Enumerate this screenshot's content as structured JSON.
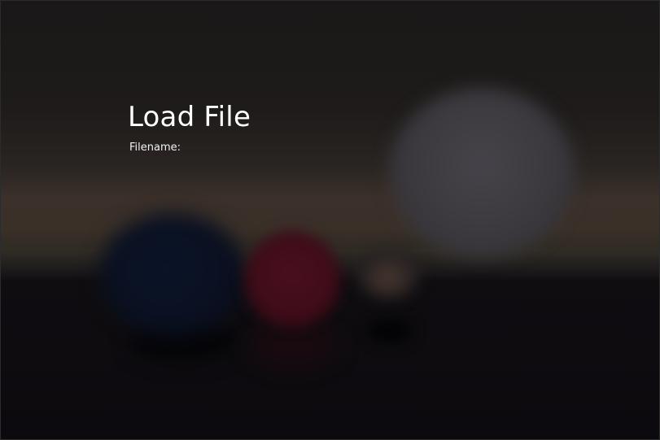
{
  "dialog": {
    "title": "Load File",
    "filename_label": "Filename:",
    "filename_value": ""
  },
  "colors": {
    "text": "#ffffff",
    "backdrop_top": "#1a1818",
    "backdrop_floor": "#0c0a0e",
    "sphere_white": "#3b393e",
    "sphere_blue": "#0a1020",
    "sphere_red": "#3e0c18"
  }
}
